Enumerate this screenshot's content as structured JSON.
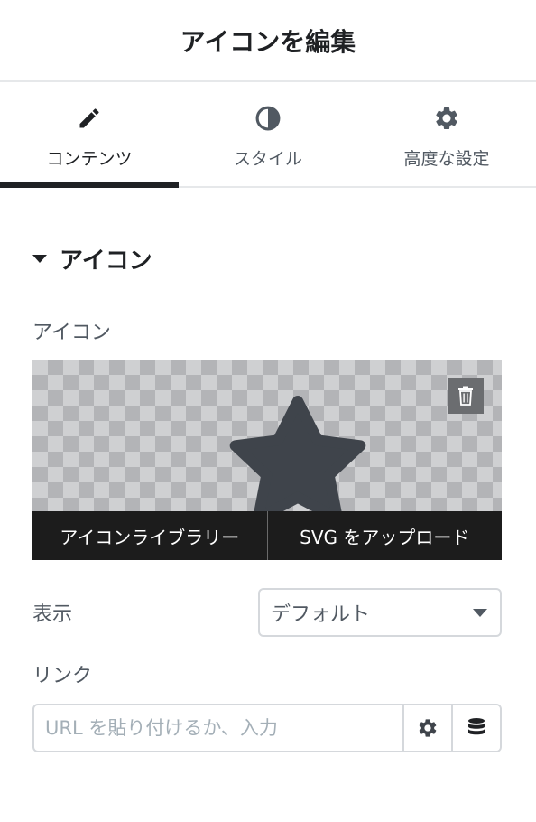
{
  "header": {
    "title": "アイコンを編集"
  },
  "tabs": [
    {
      "label": "コンテンツ",
      "icon": "pencil-icon",
      "active": true
    },
    {
      "label": "スタイル",
      "icon": "contrast-icon",
      "active": false
    },
    {
      "label": "高度な設定",
      "icon": "gear-icon",
      "active": false
    }
  ],
  "section": {
    "title": "アイコン"
  },
  "icon_field": {
    "label": "アイコン",
    "library_button": "アイコンライブラリー",
    "upload_button": "SVG をアップロード"
  },
  "view_field": {
    "label": "表示",
    "value": "デフォルト"
  },
  "link_field": {
    "label": "リンク",
    "placeholder": "URL を貼り付けるか、入力"
  },
  "colors": {
    "text": "#1f2124",
    "muted": "#515962",
    "border": "#d5d8dc",
    "star": "#3f444b",
    "overlay": "#1c1c1c"
  }
}
